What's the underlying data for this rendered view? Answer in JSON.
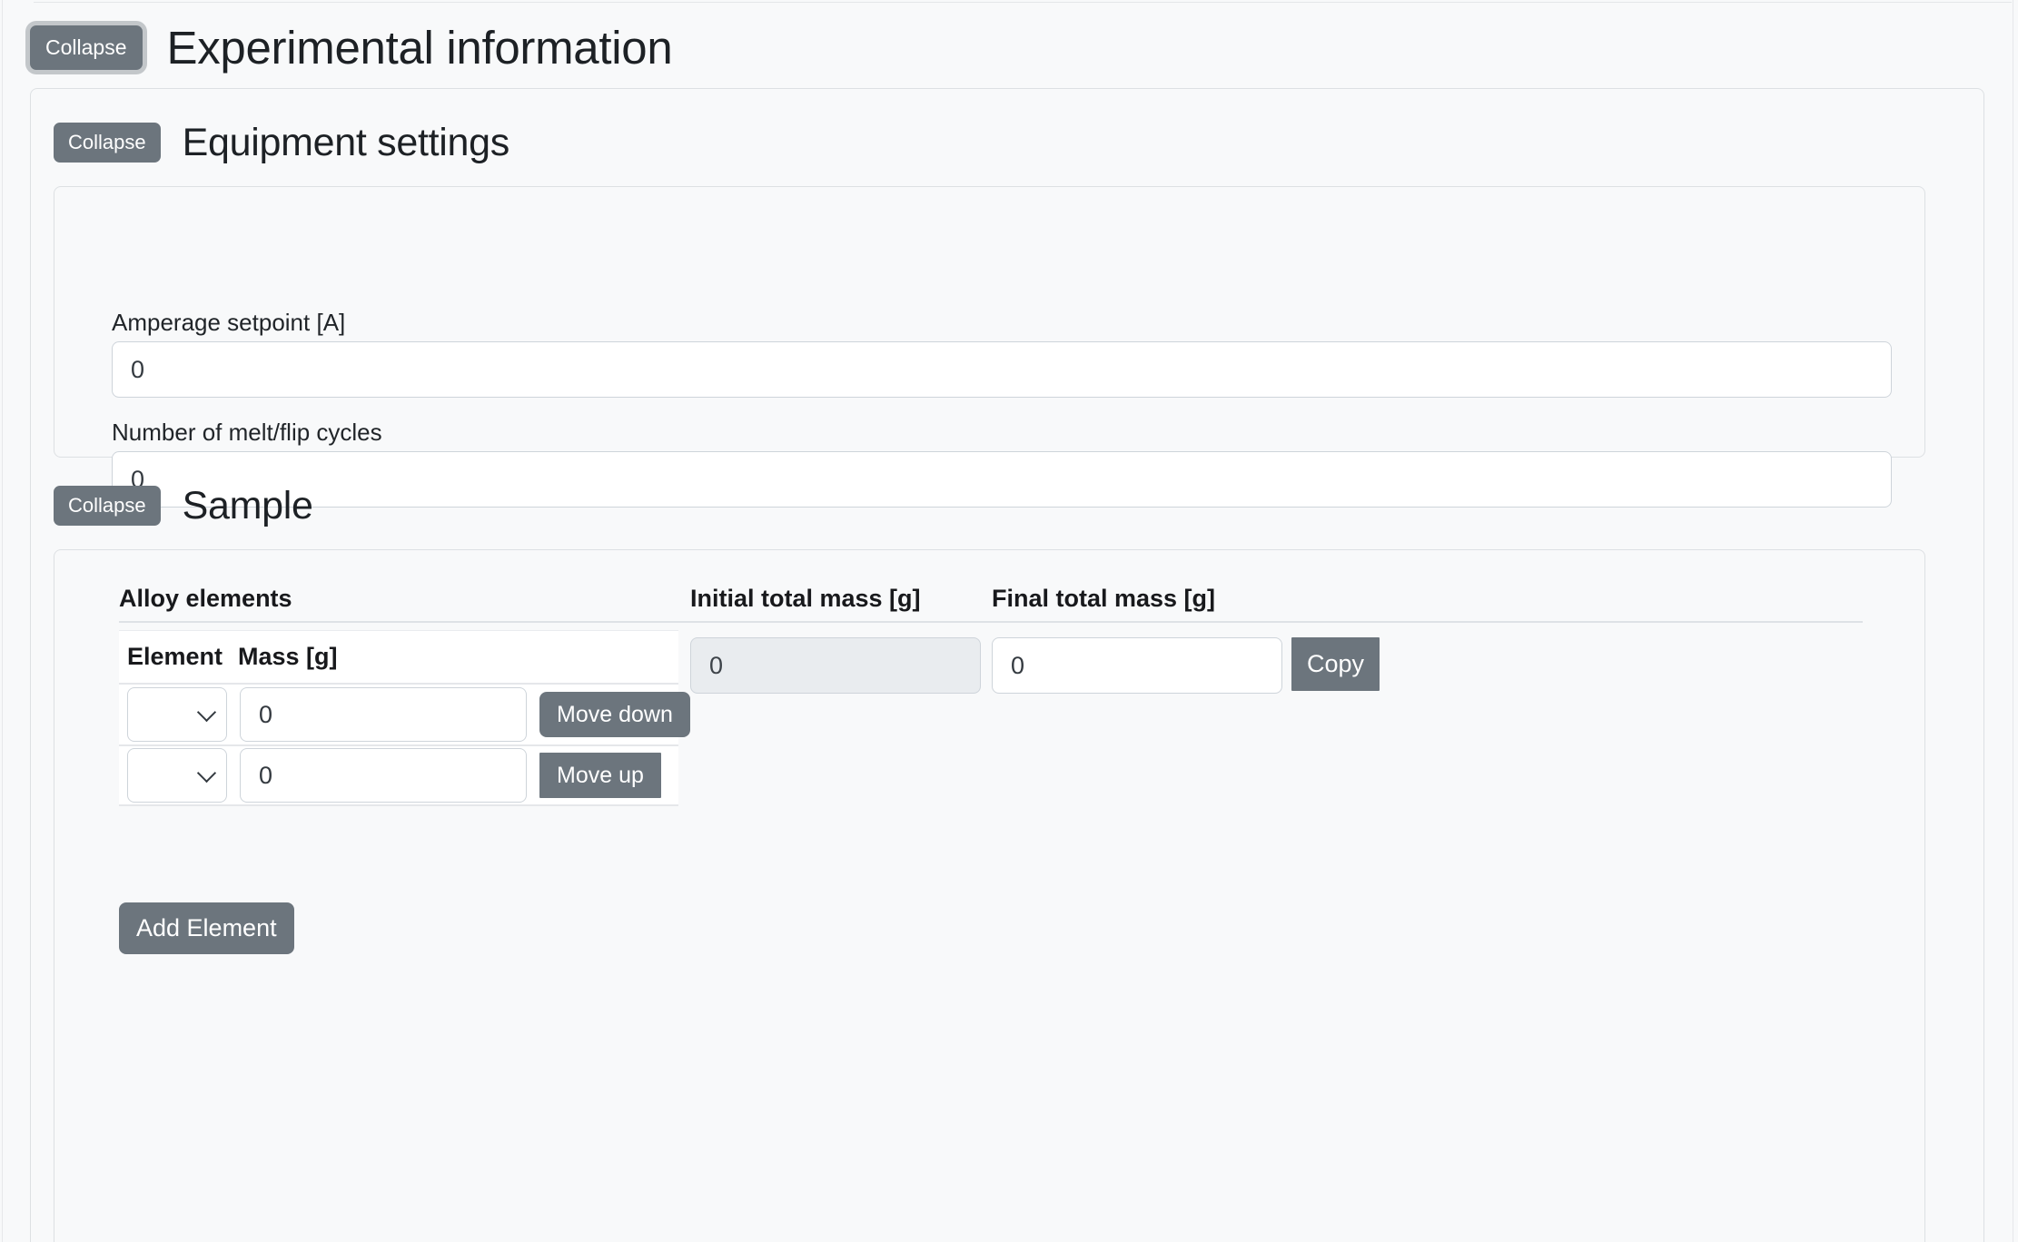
{
  "page": {
    "title": "Experimental information",
    "collapse_label": "Collapse"
  },
  "equipment": {
    "collapse_label": "Collapse",
    "title": "Equipment settings",
    "fields": [
      {
        "label": "Amperage setpoint [A]",
        "value": "0"
      },
      {
        "label": "Number of melt/flip cycles",
        "value": "0"
      }
    ]
  },
  "sample": {
    "collapse_label": "Collapse",
    "title": "Sample",
    "columns": {
      "alloy_elements": "Alloy elements",
      "initial_total_mass": "Initial total mass [g]",
      "final_total_mass": "Final total mass [g]"
    },
    "element_table": {
      "headers": [
        "Element",
        "Mass [g]"
      ],
      "rows": [
        {
          "element": "",
          "mass": "0",
          "move_label": "Move down"
        },
        {
          "element": "",
          "mass": "0",
          "move_label": "Move up"
        }
      ]
    },
    "initial_total_mass_value": "0",
    "final_total_mass_value": "0",
    "copy_label": "Copy",
    "add_element_label": "Add Element"
  },
  "colors": {
    "button_gray": "#6c757d",
    "page_bg": "#f8f9fa",
    "border": "#dde0e3",
    "disabled_bg": "#e9ecef"
  }
}
